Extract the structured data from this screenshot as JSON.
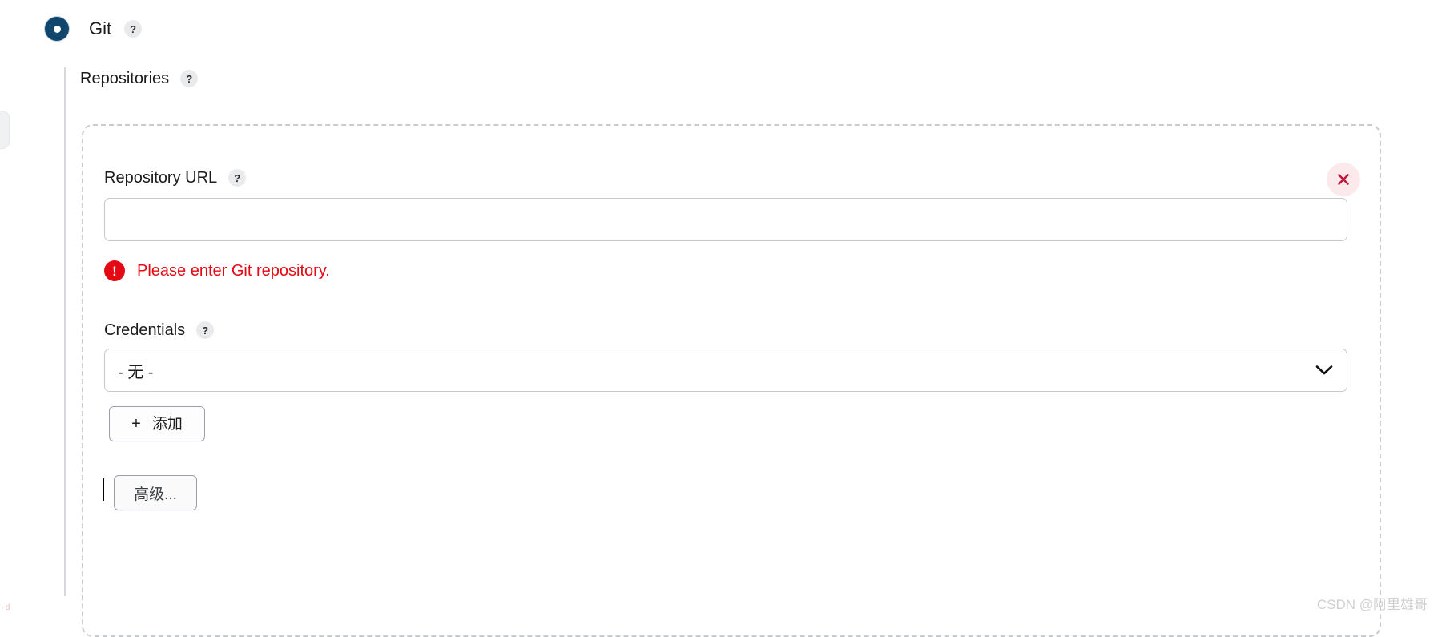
{
  "scm": {
    "selected_option_label": "Git",
    "radio_selected": true,
    "radio_color": "#10466C",
    "help_icon": "help-question-icon",
    "help_glyph": "?"
  },
  "repositories_section": {
    "heading": "Repositories",
    "help_glyph": "?"
  },
  "repository": {
    "url_field": {
      "label": "Repository URL",
      "help_glyph": "?",
      "value": "",
      "placeholder": ""
    },
    "error": {
      "icon": "error-exclamation-icon",
      "icon_glyph": "!",
      "message": "Please enter Git repository.",
      "color": "#E50914"
    },
    "credentials_field": {
      "label": "Credentials",
      "help_glyph": "?",
      "selected_value": "- 无 -",
      "chevron": "chevron-down-icon"
    },
    "add_button": {
      "plus_glyph": "+",
      "label": "添加"
    },
    "advanced_button": {
      "label": "高级..."
    },
    "remove_button": {
      "icon": "close-x-icon",
      "color": "#C2183C",
      "background": "#FBE9EC"
    }
  },
  "watermark": {
    "text": "CSDN @阿里雄哥"
  },
  "corner_mark": {
    "text": "⌐d"
  }
}
